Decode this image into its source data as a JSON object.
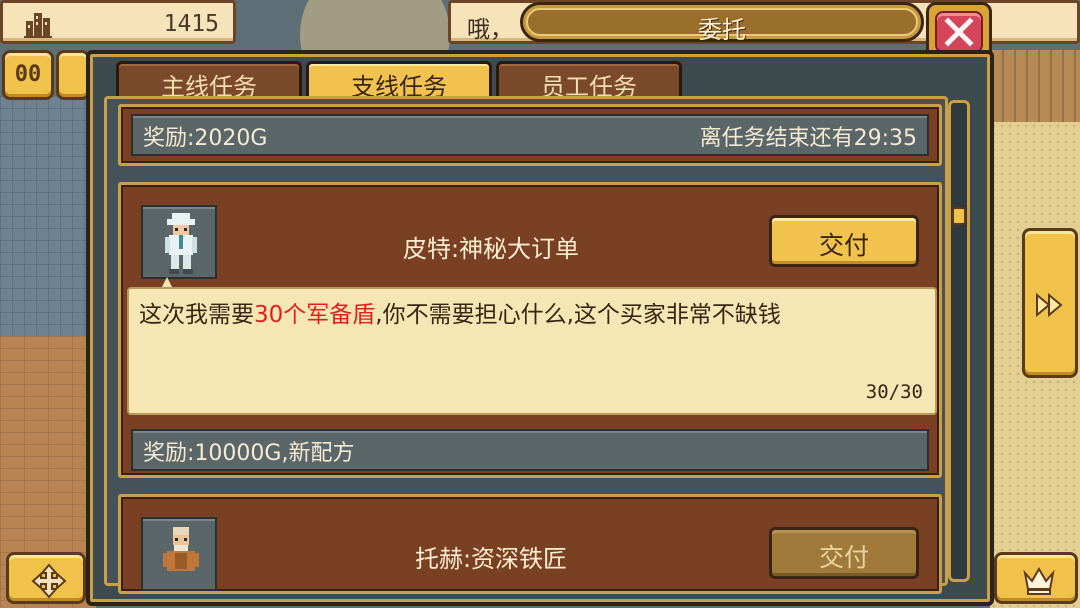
{
  "hud": {
    "money_icon": "building-icon",
    "money_value": "1415",
    "message_text": "哦，",
    "pause_label": "00"
  },
  "window": {
    "title": "委托",
    "close_icon": "close-x-icon"
  },
  "tabs": [
    {
      "label": "主线任务",
      "active": false
    },
    {
      "label": "支线任务",
      "active": true
    },
    {
      "label": "员工任务",
      "active": false
    }
  ],
  "quests": {
    "previous": {
      "reward": "奖励:2020G",
      "time_left": "离任务结束还有29:35"
    },
    "items": [
      {
        "title": "皮特:神秘大订单",
        "deliver_label": "交付",
        "deliver_enabled": true,
        "dialogue_before": "这次我需要",
        "dialogue_highlight": "30个军备盾",
        "dialogue_after": ",你不需要担心什么,这个买家非常不缺钱",
        "progress": "30/30",
        "reward": "奖励:10000G,新配方"
      },
      {
        "title": "托赫:资深铁匠",
        "deliver_label": "交付",
        "deliver_enabled": false
      }
    ]
  },
  "scroll": {
    "position_fraction": 0.05
  },
  "colors": {
    "gold": "#f2c24e",
    "card_brown": "#7a4023",
    "highlight_red": "#e21f1f",
    "close_red": "#d5455a"
  }
}
